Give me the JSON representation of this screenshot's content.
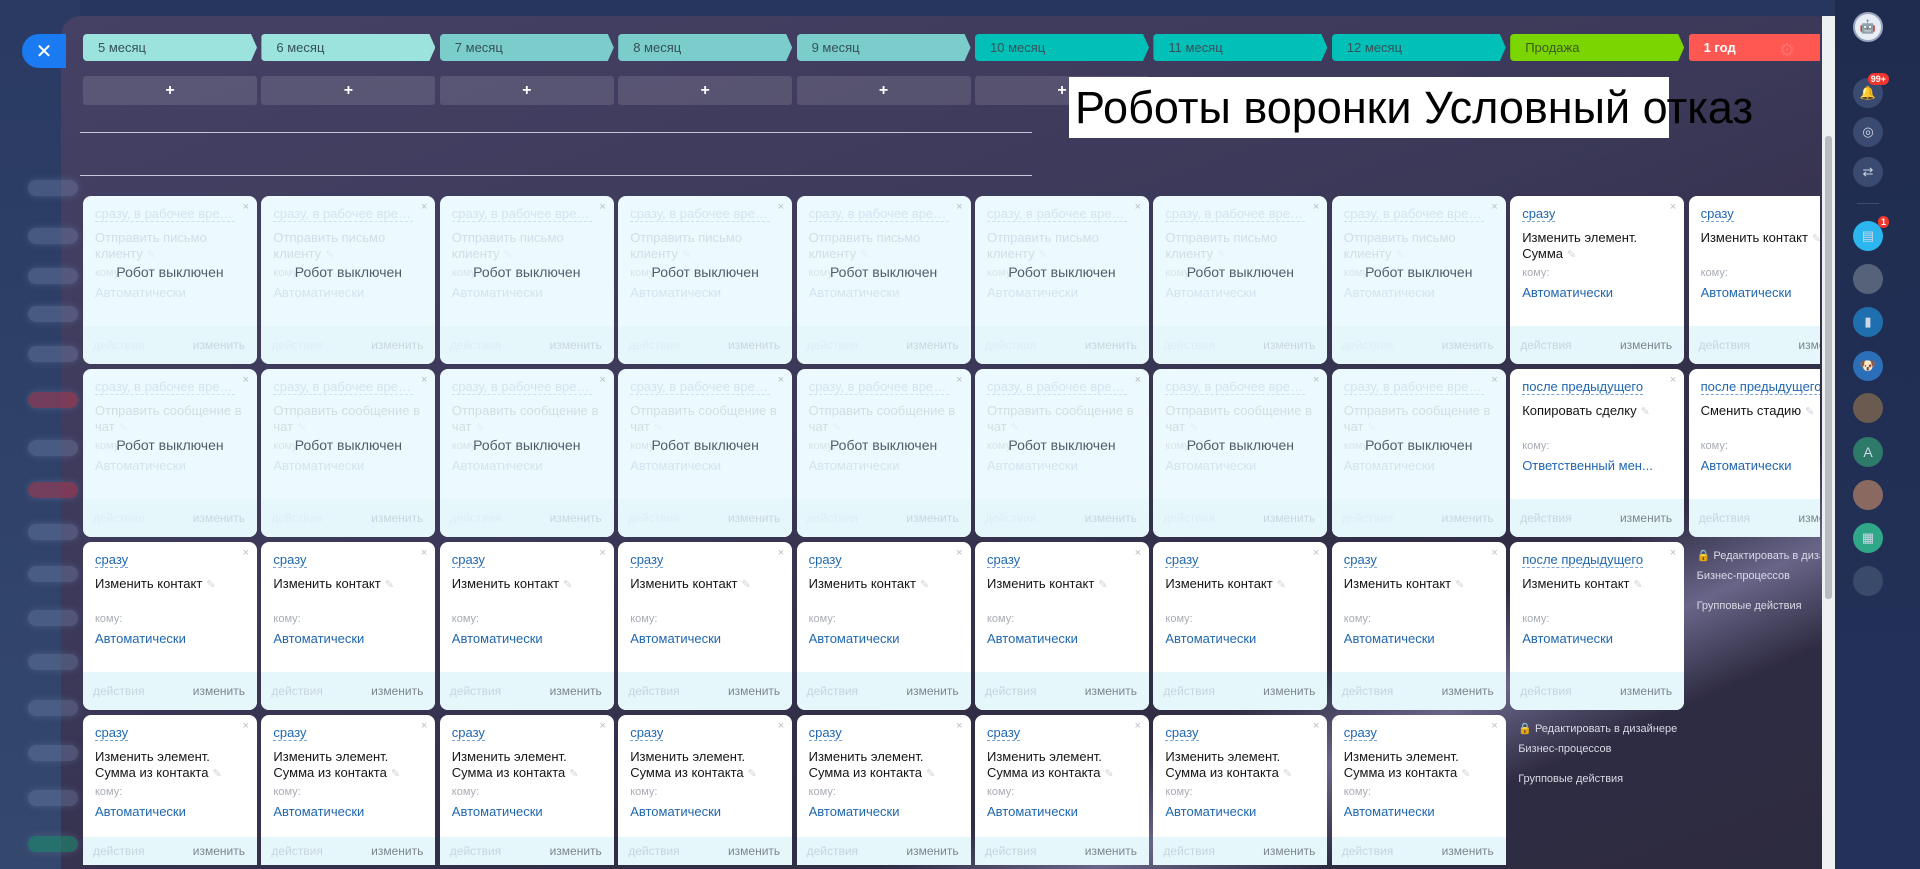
{
  "close_icon": "close-icon",
  "stages": [
    {
      "label": "5 месяц",
      "color": "#9be3dc"
    },
    {
      "label": "6 месяц",
      "color": "#9be3dc"
    },
    {
      "label": "7 месяц",
      "color": "#7acdcb"
    },
    {
      "label": "8 месяц",
      "color": "#7acdcb"
    },
    {
      "label": "9 месяц",
      "color": "#7acdcb"
    },
    {
      "label": "10 месяц",
      "color": "#00c0b8"
    },
    {
      "label": "11 месяц",
      "color": "#00c0b8"
    },
    {
      "label": "12 месяц",
      "color": "#00c0b8"
    },
    {
      "label": "Продажа",
      "color": "#7bd500"
    },
    {
      "label": "1 год",
      "color": "#ff5752"
    }
  ],
  "add_label": "+",
  "title": "Роботы воронки Условный отказ",
  "labels": {
    "to": "кому:",
    "actions": "действия",
    "edit": "изменить",
    "disabled": "Робот выключен",
    "close": "×",
    "pencil": "✎"
  },
  "robot_rows": [
    {
      "cards": [
        {
          "delay": "сразу, в рабочее время",
          "title": "Отправить письмо клиенту",
          "to": "Автоматически",
          "disabled": true
        },
        {
          "delay": "сразу, в рабочее время",
          "title": "Отправить письмо клиенту",
          "to": "Автоматически",
          "disabled": true
        },
        {
          "delay": "сразу, в рабочее время",
          "title": "Отправить письмо клиенту",
          "to": "Автоматически",
          "disabled": true
        },
        {
          "delay": "сразу, в рабочее время",
          "title": "Отправить письмо клиенту",
          "to": "Автоматически",
          "disabled": true
        },
        {
          "delay": "сразу, в рабочее время",
          "title": "Отправить письмо клиенту",
          "to": "Автоматически",
          "disabled": true
        },
        {
          "delay": "сразу, в рабочее время",
          "title": "Отправить письмо клиенту",
          "to": "Автоматически",
          "disabled": true
        },
        {
          "delay": "сразу, в рабочее время",
          "title": "Отправить письмо клиенту",
          "to": "Автоматически",
          "disabled": true
        },
        {
          "delay": "сразу, в рабочее время",
          "title": "Отправить письмо клиенту",
          "to": "Автоматически",
          "disabled": true
        },
        {
          "delay": "сразу",
          "title": "Изменить элемент. Сумма",
          "to": "Автоматически",
          "disabled": false
        },
        {
          "delay": "сразу",
          "title": "Изменить контакт",
          "to": "Автоматически",
          "disabled": false
        }
      ]
    },
    {
      "cards": [
        {
          "delay": "сразу, в рабочее врем...",
          "title": "Отправить сообщение в чат",
          "to": "Автоматически",
          "disabled": true
        },
        {
          "delay": "сразу, в рабочее врем...",
          "title": "Отправить сообщение в чат",
          "to": "Автоматически",
          "disabled": true
        },
        {
          "delay": "сразу, в рабочее врем...",
          "title": "Отправить сообщение в чат",
          "to": "Автоматически",
          "disabled": true
        },
        {
          "delay": "сразу, в рабочее врем...",
          "title": "Отправить сообщение в чат",
          "to": "Автоматически",
          "disabled": true
        },
        {
          "delay": "сразу, в рабочее врем...",
          "title": "Отправить сообщение в чат",
          "to": "Автоматически",
          "disabled": true
        },
        {
          "delay": "сразу, в рабочее врем...",
          "title": "Отправить сообщение в чат",
          "to": "Автоматически",
          "disabled": true
        },
        {
          "delay": "сразу, в рабочее врем...",
          "title": "Отправить сообщение в чат",
          "to": "Автоматически",
          "disabled": true
        },
        {
          "delay": "сразу, в рабочее врем...",
          "title": "Отправить сообщение в чат",
          "to": "Автоматически",
          "disabled": true
        },
        {
          "delay": "после предыдущего",
          "title": "Копировать сделку",
          "to": "Ответственный мен...",
          "disabled": false
        },
        {
          "delay": "после предыдущего",
          "title": "Сменить стадию",
          "to": "Автоматически",
          "disabled": false
        }
      ]
    },
    {
      "cards": [
        {
          "delay": "сразу",
          "title": "Изменить контакт",
          "to": "Автоматически",
          "disabled": false
        },
        {
          "delay": "сразу",
          "title": "Изменить контакт",
          "to": "Автоматически",
          "disabled": false
        },
        {
          "delay": "сразу",
          "title": "Изменить контакт",
          "to": "Автоматически",
          "disabled": false
        },
        {
          "delay": "сразу",
          "title": "Изменить контакт",
          "to": "Автоматически",
          "disabled": false
        },
        {
          "delay": "сразу",
          "title": "Изменить контакт",
          "to": "Автоматически",
          "disabled": false
        },
        {
          "delay": "сразу",
          "title": "Изменить контакт",
          "to": "Автоматически",
          "disabled": false
        },
        {
          "delay": "сразу",
          "title": "Изменить контакт",
          "to": "Автоматически",
          "disabled": false
        },
        {
          "delay": "сразу",
          "title": "Изменить контакт",
          "to": "Автоматически",
          "disabled": false
        },
        {
          "delay": "после предыдущего",
          "title": "Изменить контакт",
          "to": "Автоматически",
          "disabled": false
        },
        "links"
      ]
    },
    {
      "cards": [
        {
          "delay": "сразу",
          "title": "Изменить элемент. Сумма из контакта",
          "to": "Автоматически",
          "disabled": false
        },
        {
          "delay": "сразу",
          "title": "Изменить элемент. Сумма из контакта",
          "to": "Автоматически",
          "disabled": false
        },
        {
          "delay": "сразу",
          "title": "Изменить элемент. Сумма из контакта",
          "to": "Автоматически",
          "disabled": false
        },
        {
          "delay": "сразу",
          "title": "Изменить элемент. Сумма из контакта",
          "to": "Автоматически",
          "disabled": false
        },
        {
          "delay": "сразу",
          "title": "Изменить элемент. Сумма из контакта",
          "to": "Автоматически",
          "disabled": false
        },
        {
          "delay": "сразу",
          "title": "Изменить элемент. Сумма из контакта",
          "to": "Автоматически",
          "disabled": false
        },
        {
          "delay": "сразу",
          "title": "Изменить элемент. Сумма из контакта",
          "to": "Автоматически",
          "disabled": false
        },
        {
          "delay": "сразу",
          "title": "Изменить элемент. Сумма из контакта",
          "to": "Автоматически",
          "disabled": false
        },
        "links",
        null
      ]
    }
  ],
  "links": {
    "designer": "Редактировать в дизайнере Бизнес-процессов",
    "group": "Групповые действия",
    "lock_icon": "lock-icon"
  },
  "right_sidebar": {
    "notifications_badge": "99+",
    "chat_badge": "1",
    "avatar_letter": "A",
    "icons": [
      "robot-avatar",
      "bell-icon",
      "target-icon",
      "chat-transfer-icon",
      "chat-icon",
      "user-avatar",
      "bookmark-icon",
      "dog-avatar",
      "user-avatar",
      "letter-avatar",
      "user-avatar",
      "news-icon",
      "user-avatar"
    ]
  }
}
